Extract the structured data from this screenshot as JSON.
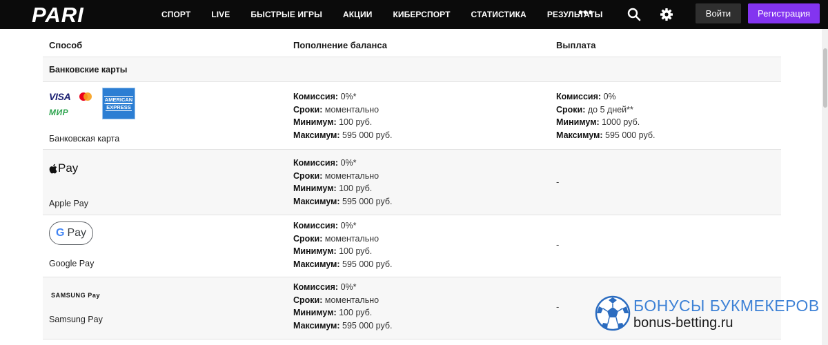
{
  "header": {
    "logo_text": "PARI",
    "nav": [
      "СПОРТ",
      "LIVE",
      "БЫСТРЫЕ ИГРЫ",
      "АКЦИИ",
      "КИБЕРСПОРТ",
      "СТАТИСТИКА",
      "РЕЗУЛЬТАТЫ"
    ],
    "more_label": "•••",
    "search_icon": "search-icon",
    "settings_icon": "gear-icon",
    "login_label": "Войти",
    "register_label": "Регистрация",
    "colors": {
      "bar": "#0b0b0b",
      "register": "#8334f0",
      "login": "#2f2f2f"
    }
  },
  "table": {
    "columns": [
      "Способ",
      "Пополнение баланса",
      "Выплата"
    ],
    "category": "Банковские карты",
    "labels": {
      "fee": "Комиссия:",
      "term": "Сроки:",
      "min": "Минимум:",
      "max": "Максимум:"
    },
    "rows": [
      {
        "method": "Банковская карта",
        "logos": {
          "visa": "VISA",
          "mir": "МИР",
          "amex_top": "AMERICAN",
          "amex_bottom": "EXPRESS"
        },
        "deposit": {
          "fee": "0%*",
          "term": "моментально",
          "min": "100 руб.",
          "max": "595 000 руб."
        },
        "payout": {
          "fee": "0%",
          "term": "до 5 дней**",
          "min": "1000 руб.",
          "max": "595 000 руб."
        }
      },
      {
        "method": "Apple Pay",
        "logo_text": "Pay",
        "deposit": {
          "fee": "0%*",
          "term": "моментально",
          "min": "100 руб.",
          "max": "595 000 руб."
        },
        "payout_dash": "-"
      },
      {
        "method": "Google Pay",
        "logo_g": "G",
        "logo_text": "Pay",
        "deposit": {
          "fee": "0%*",
          "term": "моментально",
          "min": "100 руб.",
          "max": "595 000 руб."
        },
        "payout_dash": "-"
      },
      {
        "method": "Samsung Pay",
        "logo_text": "SAMSUNG Pay",
        "deposit": {
          "fee": "0%*",
          "term": "моментально",
          "min": "100 руб.",
          "max": "595 000 руб."
        },
        "payout_dash": "-"
      }
    ]
  },
  "watermark": {
    "line1": "БОНУСЫ БУКМЕКЕРОВ",
    "line2": "bonus-betting.ru",
    "color": "#3e82d6"
  }
}
